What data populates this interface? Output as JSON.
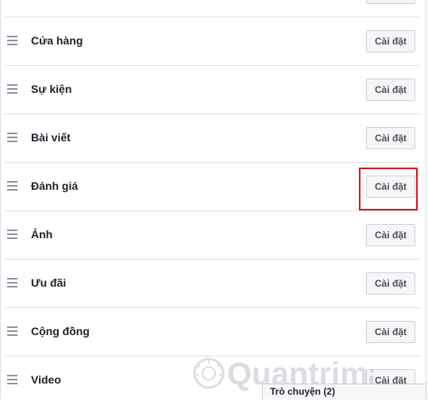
{
  "tabs_list": {
    "settings_button_label": "Cài đặt",
    "items": [
      {
        "label": "Cửa hàng"
      },
      {
        "label": "Sự kiện"
      },
      {
        "label": "Bài viết"
      },
      {
        "label": "Đánh giá"
      },
      {
        "label": "Ảnh"
      },
      {
        "label": "Ưu đãi"
      },
      {
        "label": "Cộng đồng"
      },
      {
        "label": "Video"
      }
    ]
  },
  "chat": {
    "label": "Trò chuyện (2)"
  },
  "watermark": {
    "text": "Quantrimang"
  },
  "colors": {
    "highlight": "#e0141b",
    "divider": "#dddfe2",
    "button_bg": "#f5f6f7"
  }
}
